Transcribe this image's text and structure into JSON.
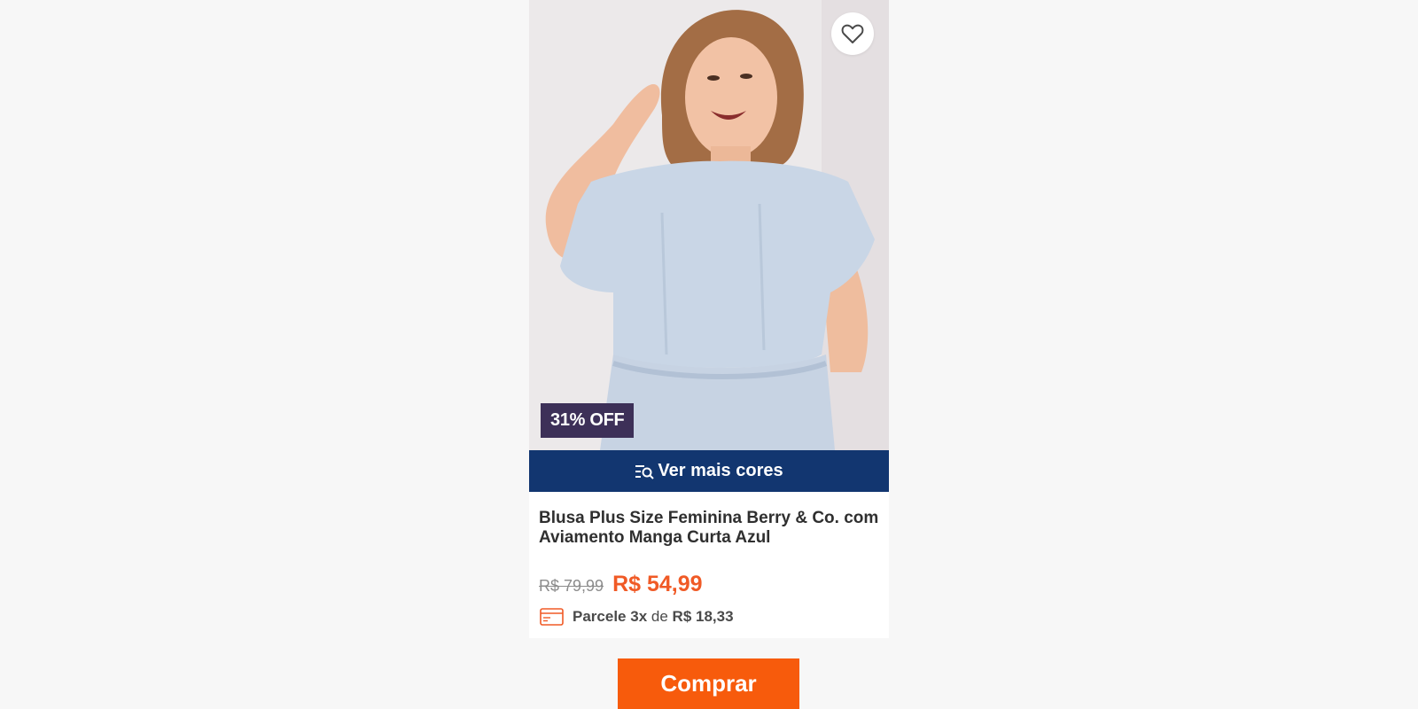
{
  "product": {
    "discount_badge": "31% OFF",
    "more_colors_label": "Ver mais cores",
    "title_line1": "Blusa Plus Size Feminina Berry & Co. com",
    "title_line2": "Aviamento Manga Curta Azul",
    "old_price": "R$ 79,99",
    "price": "R$ 54,99",
    "installment": {
      "prefix": "Parcele",
      "count": "3x",
      "connector": "de",
      "amount": "R$ 18,33"
    }
  },
  "buy_button_label": "Comprar",
  "icons": {
    "favorite": "heart-outline-icon",
    "more_colors": "filter-search-icon",
    "installment": "credit-card-icon"
  },
  "colors": {
    "badge_bg": "#3d3058",
    "colors_bar_bg": "#123670",
    "price": "#f05a26",
    "buy_button": "#f75b0c"
  }
}
